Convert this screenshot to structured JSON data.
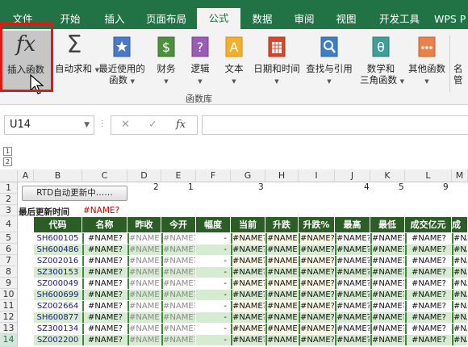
{
  "tabs": [
    {
      "label": "文件",
      "active": false
    },
    {
      "label": "开始",
      "active": false
    },
    {
      "label": "插入",
      "active": false
    },
    {
      "label": "页面布局",
      "active": false
    },
    {
      "label": "公式",
      "active": true
    },
    {
      "label": "数据",
      "active": false
    },
    {
      "label": "审阅",
      "active": false
    },
    {
      "label": "视图",
      "active": false
    },
    {
      "label": "开发工具",
      "active": false
    },
    {
      "label": "WPS P",
      "active": false
    }
  ],
  "ribbon": {
    "insert_function": {
      "glyph": "fx",
      "label": "插入函数"
    },
    "autosum": {
      "label": "自动求和"
    },
    "recent": {
      "label1": "最近使用的",
      "label2": "函数"
    },
    "finance": {
      "label": "财务"
    },
    "logic": {
      "label": "逻辑"
    },
    "text": {
      "label": "文本"
    },
    "datetime": {
      "label": "日期和时间"
    },
    "lookup": {
      "label": "查找与引用"
    },
    "math": {
      "label1": "数学和",
      "label2": "三角函数"
    },
    "other": {
      "label": "其他函数"
    },
    "cut_off": {
      "label1": "名",
      "label2": "管"
    },
    "group_label": "函数库"
  },
  "formula_bar": {
    "name_box": "U14",
    "cancel_glyph": "✕",
    "confirm_glyph": "✓",
    "fx_glyph": "fx",
    "formula": ""
  },
  "outline_levels": [
    "1",
    "2"
  ],
  "columns": [
    "A",
    "B",
    "C",
    "D",
    "E",
    "F",
    "G",
    "H",
    "I",
    "J",
    "K",
    "L",
    "M"
  ],
  "rows": [
    "1",
    "2",
    "3",
    "4",
    "5",
    "6",
    "7",
    "8",
    "9",
    "10",
    "11",
    "12",
    "13",
    "14"
  ],
  "sheet": {
    "rtd_button": "RTD自动更新中……",
    "row1_numbers": [
      "2",
      "1",
      "3",
      "4",
      "5",
      "9"
    ],
    "last_update_label": "最后更新时间",
    "last_update_value": "#NAME?",
    "headers": [
      "代码",
      "名称",
      "昨收",
      "今开",
      "幅度",
      "当前",
      "升跌",
      "升跌%",
      "最高",
      "最低",
      "成交亿元",
      "成交"
    ],
    "codes": [
      "SH600105",
      "SH600486",
      "SZ002016",
      "SZ300153",
      "SZ000049",
      "SH600699",
      "SZ002664",
      "SH600877",
      "SZ300134",
      "SZ002200"
    ],
    "name_error": "#NAME?",
    "dash": "-"
  },
  "colors": {
    "ribbon_green": "#217346",
    "header_green": "#2d5d27",
    "row_light": "#d6ecd0",
    "row_white": "#ffffff",
    "row_cream": "#fdf7e6",
    "highlight_red": "#e21818",
    "error_red": "#c00000"
  }
}
